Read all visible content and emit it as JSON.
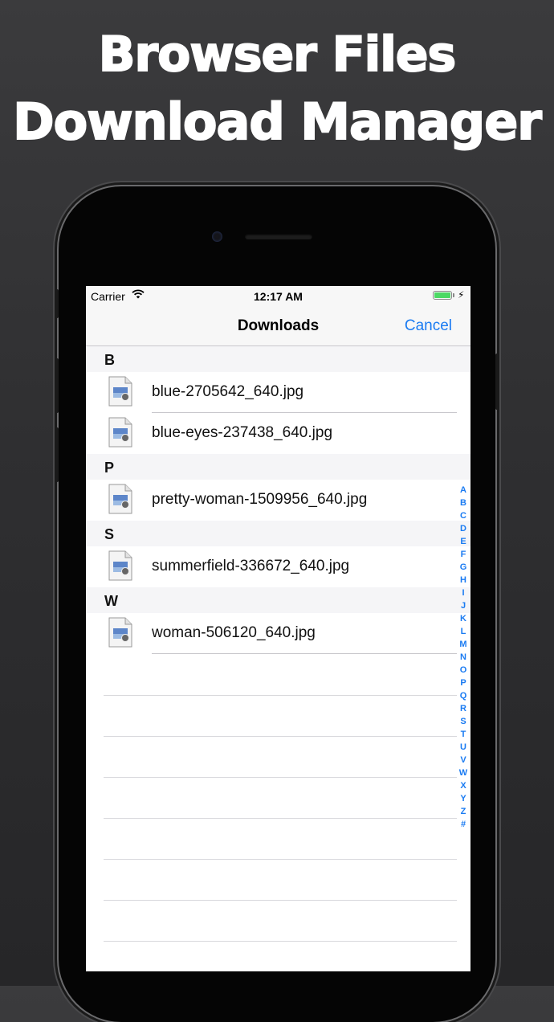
{
  "promo": {
    "line1": "Browser Files",
    "line2": "Download Manager"
  },
  "status_bar": {
    "carrier": "Carrier",
    "time": "12:17 AM"
  },
  "nav": {
    "title": "Downloads",
    "cancel_label": "Cancel"
  },
  "sections": [
    {
      "letter": "B",
      "files": [
        "blue-2705642_640.jpg",
        "blue-eyes-237438_640.jpg"
      ]
    },
    {
      "letter": "P",
      "files": [
        "pretty-woman-1509956_640.jpg"
      ]
    },
    {
      "letter": "S",
      "files": [
        "summerfield-336672_640.jpg"
      ]
    },
    {
      "letter": "W",
      "files": [
        "woman-506120_640.jpg"
      ]
    }
  ],
  "index_letters": [
    "A",
    "B",
    "C",
    "D",
    "E",
    "F",
    "G",
    "H",
    "I",
    "J",
    "K",
    "L",
    "M",
    "N",
    "O",
    "P",
    "Q",
    "R",
    "S",
    "T",
    "U",
    "V",
    "W",
    "X",
    "Y",
    "Z",
    "#"
  ],
  "colors": {
    "accent": "#1a7bf2",
    "battery": "#4cd964"
  }
}
